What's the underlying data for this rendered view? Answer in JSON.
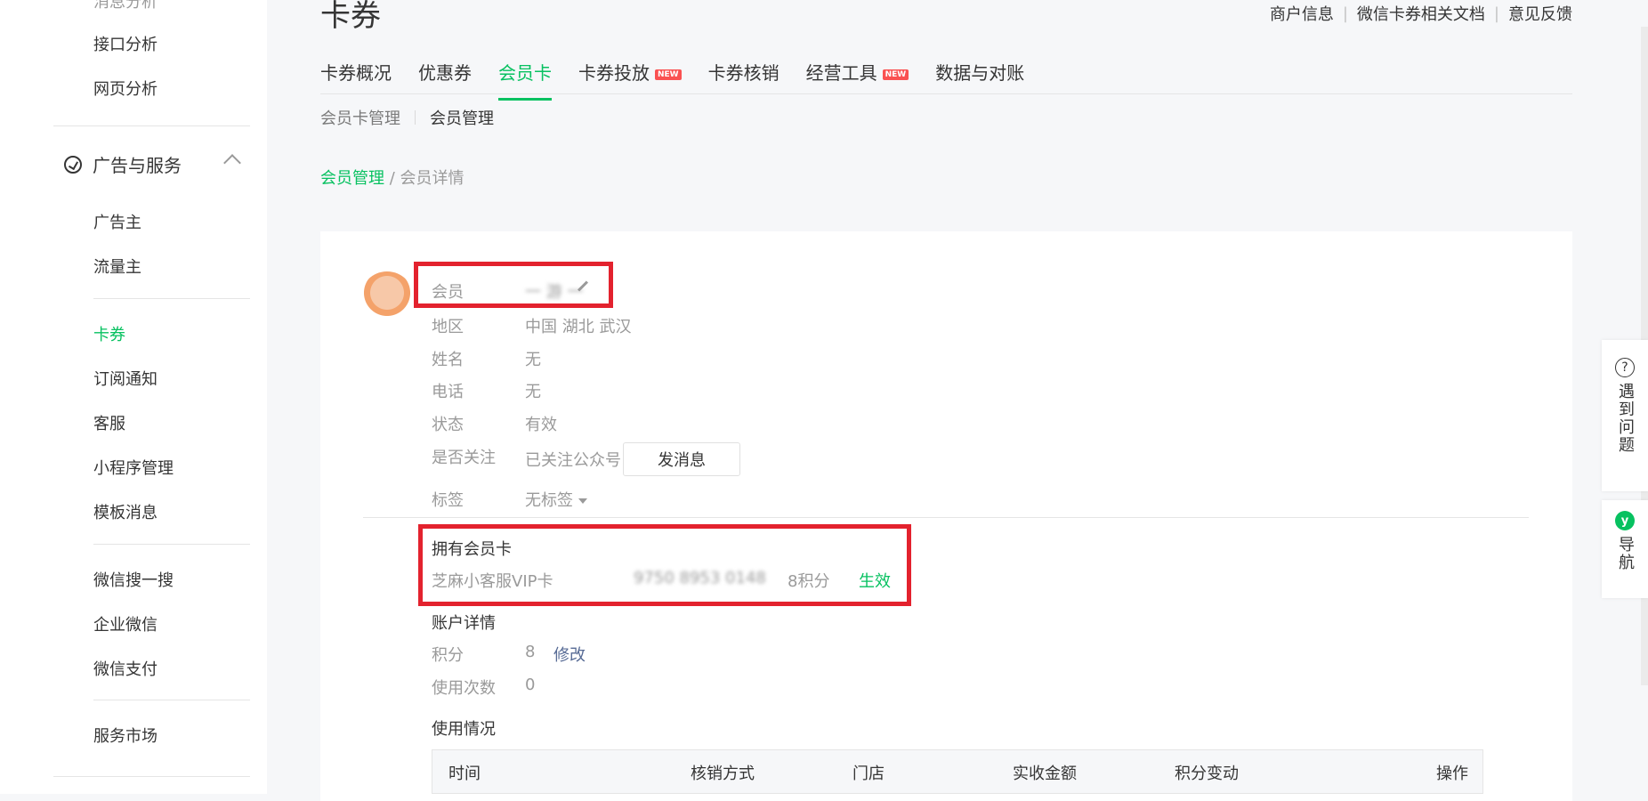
{
  "sidebar": {
    "top_partial": "消息分析",
    "items_top": [
      "接口分析",
      "网页分析"
    ],
    "group_title": "广告与服务",
    "group_items": [
      "广告主",
      "流量主"
    ],
    "items_mid": [
      "卡券",
      "订阅通知",
      "客服",
      "小程序管理",
      "模板消息"
    ],
    "items_bottom": [
      "微信搜一搜",
      "企业微信",
      "微信支付"
    ],
    "items_last": [
      "服务市场"
    ],
    "active": "卡券"
  },
  "header": {
    "title": "卡券",
    "links": [
      "商户信息",
      "微信卡券相关文档",
      "意见反馈"
    ]
  },
  "tabs": [
    {
      "label": "卡券概况",
      "badge": ""
    },
    {
      "label": "优惠券",
      "badge": ""
    },
    {
      "label": "会员卡",
      "badge": "",
      "active": true
    },
    {
      "label": "卡券投放",
      "badge": "NEW"
    },
    {
      "label": "卡券核销",
      "badge": ""
    },
    {
      "label": "经营工具",
      "badge": "NEW"
    },
    {
      "label": "数据与对账",
      "badge": ""
    }
  ],
  "subtabs": [
    "会员卡管理",
    "会员管理"
  ],
  "breadcrumb": {
    "link": "会员管理",
    "separator": " / ",
    "current": "会员详情"
  },
  "member": {
    "rows": [
      {
        "label": "会员",
        "value": "一 游 一"
      },
      {
        "label": "地区",
        "value": "中国 湖北 武汉"
      },
      {
        "label": "姓名",
        "value": "无"
      },
      {
        "label": "电话",
        "value": "无"
      },
      {
        "label": "状态",
        "value": "有效"
      },
      {
        "label": "是否关注",
        "value": "已关注公众号"
      },
      {
        "label": "标签",
        "value": "无标签"
      }
    ],
    "send_button": "发消息"
  },
  "cards": {
    "title": "拥有会员卡",
    "name": "芝麻小客服VIP卡",
    "number": "9750 8953 0148",
    "points": "8积分",
    "status": "生效"
  },
  "account": {
    "title": "账户详情",
    "points_label": "积分",
    "points_value": "8",
    "modify": "修改",
    "uses_label": "使用次数",
    "uses_value": "0"
  },
  "usage": {
    "title": "使用情况",
    "columns": [
      "时间",
      "核销方式",
      "门店",
      "实收金额",
      "积分变动",
      "操作"
    ]
  },
  "float": {
    "help": "遇到问题",
    "nav": "导航"
  }
}
